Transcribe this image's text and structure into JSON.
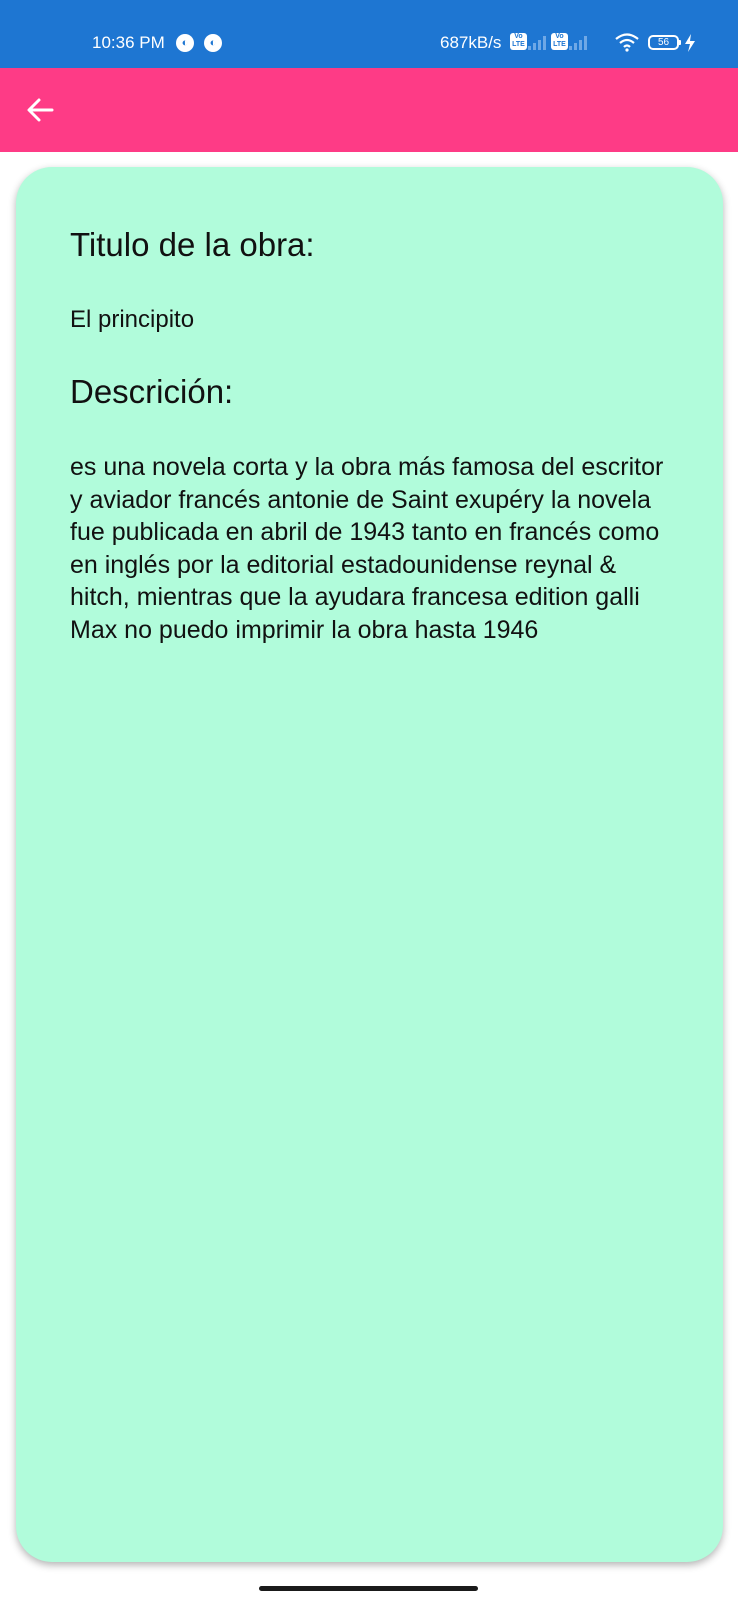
{
  "status_bar": {
    "time": "10:36 PM",
    "network_speed": "687kB/s",
    "volte_label": "Vo LTE",
    "battery_level": "56",
    "colors": {
      "background": "#1e76d2",
      "foreground": "#ffffff"
    }
  },
  "app_bar": {
    "back_icon": "arrow-left-icon",
    "color": "#fe3b86"
  },
  "card": {
    "background": "#b1fcdb",
    "title_heading": "Titulo de la obra:",
    "title_value": "El principito",
    "description_heading": "Descrición:",
    "description_text": "es una novela corta y la obra más famosa del escritor y aviador francés antonie de Saint exupéry la novela fue publicada en abril de 1943 tanto en francés como en inglés por la editorial estadounidense reynal & hitch, mientras que la ayudara francesa edition galli Max no puedo imprimir la obra hasta 1946"
  }
}
